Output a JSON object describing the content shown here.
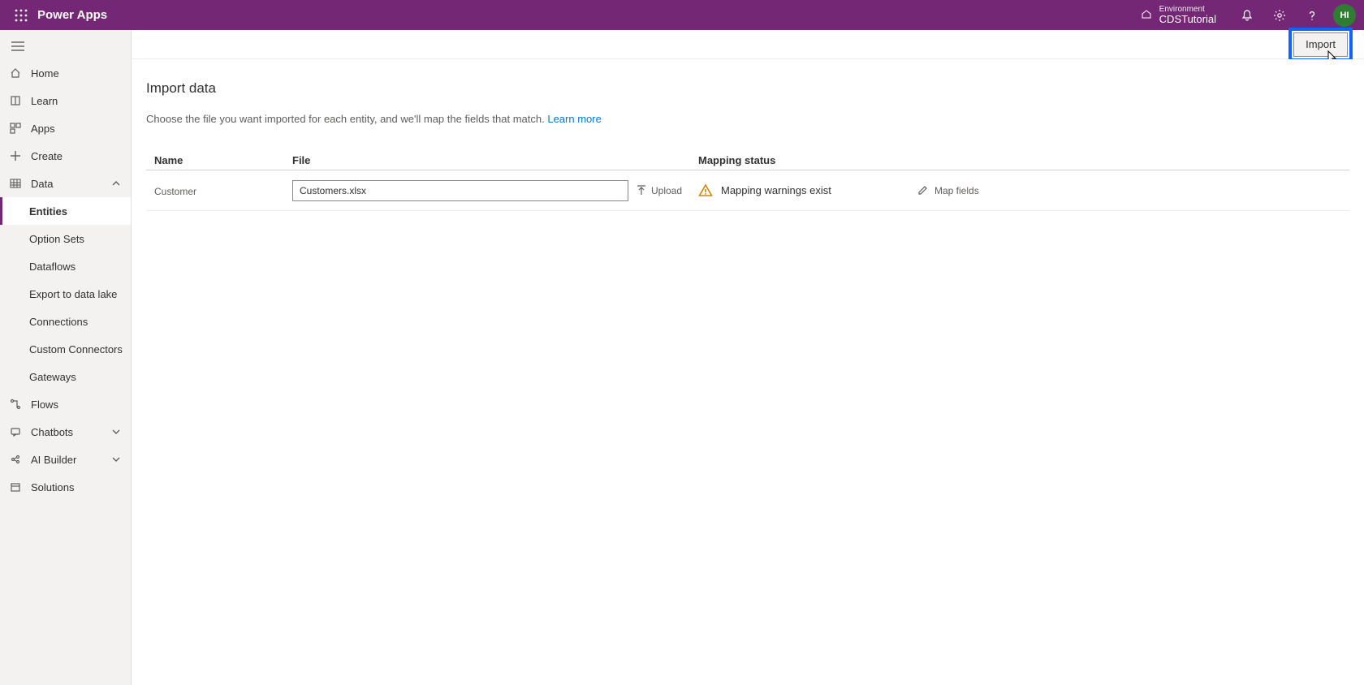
{
  "header": {
    "app_title": "Power Apps",
    "environment_label": "Environment",
    "environment_name": "CDSTutorial",
    "avatar_initials": "HI"
  },
  "command_bar": {
    "import_label": "Import"
  },
  "sidebar": {
    "items": [
      {
        "icon": "home-icon",
        "label": "Home"
      },
      {
        "icon": "learn-icon",
        "label": "Learn"
      },
      {
        "icon": "apps-icon",
        "label": "Apps"
      },
      {
        "icon": "create-icon",
        "label": "Create"
      },
      {
        "icon": "data-icon",
        "label": "Data",
        "expanded": true
      },
      {
        "icon": "flows-icon",
        "label": "Flows"
      },
      {
        "icon": "chatbots-icon",
        "label": "Chatbots",
        "chevron": true
      },
      {
        "icon": "aibuilder-icon",
        "label": "AI Builder",
        "chevron": true
      },
      {
        "icon": "solutions-icon",
        "label": "Solutions"
      }
    ],
    "data_children": [
      {
        "label": "Entities",
        "active": true
      },
      {
        "label": "Option Sets"
      },
      {
        "label": "Dataflows"
      },
      {
        "label": "Export to data lake"
      },
      {
        "label": "Connections"
      },
      {
        "label": "Custom Connectors"
      },
      {
        "label": "Gateways"
      }
    ]
  },
  "page": {
    "title": "Import data",
    "description_prefix": "Choose the file you want imported for each entity, and we'll map the fields that match. ",
    "learn_more": "Learn more"
  },
  "table": {
    "columns": {
      "name": "Name",
      "file": "File",
      "status": "Mapping status"
    },
    "row": {
      "name": "Customer",
      "file_value": "Customers.xlsx",
      "upload_label": "Upload",
      "status_text": "Mapping warnings exist",
      "map_fields_label": "Map fields"
    }
  }
}
